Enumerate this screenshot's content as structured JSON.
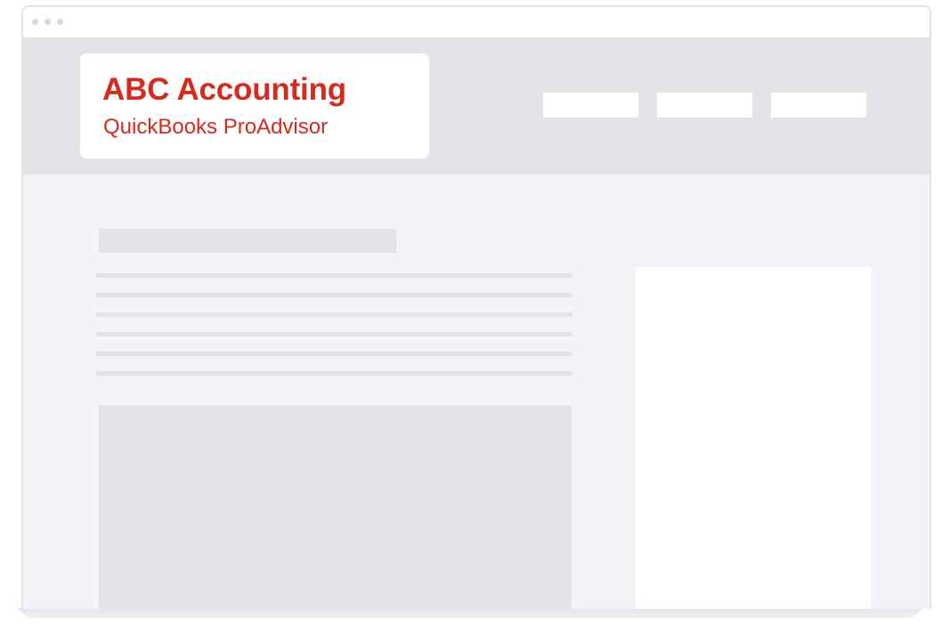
{
  "browser": {
    "window_controls": [
      "close",
      "minimize",
      "maximize"
    ]
  },
  "header": {
    "brand_name": "ABC Accounting",
    "brand_tagline": "QuickBooks ProAdvisor",
    "brand_color": "#d52b1e",
    "nav_item_count": 3
  },
  "colors": {
    "page_background": "#f3f4f8",
    "header_background": "#e3e4e8",
    "placeholder": "#e3e4e8",
    "card": "#ffffff"
  }
}
